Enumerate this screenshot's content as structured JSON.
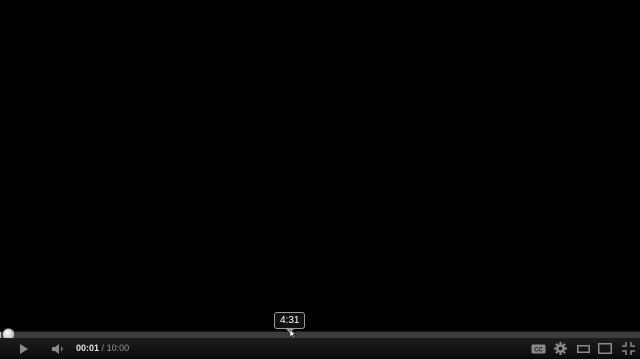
{
  "player": {
    "current_time": "00:01",
    "separator": "/",
    "duration": "10:00",
    "hover_time": "4:31",
    "progress_fraction": 0.002,
    "hover_fraction": 0.4517,
    "colors": {
      "background": "#000000",
      "controls": "#141414",
      "track": "#3c3c3c",
      "played": "#c8c8c8",
      "icon": "#8a8a8a"
    }
  },
  "icons": [
    "play-icon",
    "volume-icon",
    "captions-icon",
    "settings-gear-icon",
    "small-player-icon",
    "large-player-icon",
    "fullscreen-icon"
  ]
}
